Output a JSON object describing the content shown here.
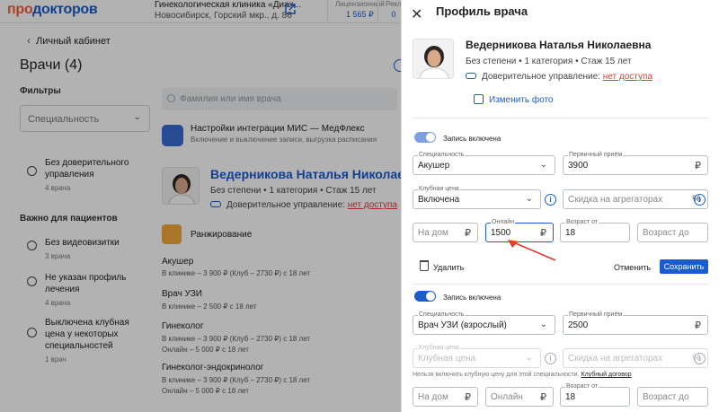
{
  "header": {
    "logo_prefix": "про",
    "logo_main": "докторов",
    "clinic_name": "Гинекологическая клиника «Диах...",
    "clinic_address": "Новосибирск, Горский мкр., д. 86",
    "stats": [
      {
        "label": "Лицензионный",
        "value": "1 565 ₽"
      },
      {
        "label": "Рекл",
        "value": "0"
      }
    ]
  },
  "background": {
    "back_link": "Личный кабинет",
    "page_title": "Врачи (4)",
    "filters_title": "Фильтры",
    "specialty_placeholder": "Специальность",
    "filter_trust": {
      "label": "Без доверительного управления",
      "count": "4 врача"
    },
    "important_title": "Важно для пациентов",
    "filters": [
      {
        "label": "Без видеовизитки",
        "count": "3 врача"
      },
      {
        "label": "Не указан профиль лечения",
        "count": "4 врача"
      },
      {
        "label": "Выключена клубная цена у некоторых специальностей",
        "count": "1 врач"
      }
    ],
    "search_placeholder": "Фамилия или имя врача",
    "mis": {
      "title": "Настройки интеграции МИС — МедФлекс",
      "subtitle": "Включение и выключение записи, выгрузка расписания"
    },
    "doctor": {
      "name": "Ведерникова Наталья Николаевна",
      "meta": "Без степени  •  1 категория  •  Стаж 15 лет",
      "trust_label": "Доверительное управление:",
      "trust_value": "нет доступа"
    },
    "ranking_label": "Ранжирование",
    "services": [
      {
        "name": "Акушер",
        "lines": [
          "В клинике – 3 900 ₽ (Клуб – 2730 ₽) с 18 лет"
        ]
      },
      {
        "name": "Врач УЗИ",
        "lines": [
          "В клинике – 2 500 ₽ с 18 лет"
        ]
      },
      {
        "name": "Гинеколог",
        "lines": [
          "В клинике – 3 900 ₽ (Клуб – 2730 ₽) с 18 лет",
          "Онлайн – 5 000 ₽ с 18 лет"
        ]
      },
      {
        "name": "Гинеколог-эндокринолог",
        "lines": [
          "В клинике – 3 900 ₽ (Клуб – 2730 ₽) с 18 лет",
          "Онлайн – 5 000 ₽ с 18 лет"
        ]
      }
    ]
  },
  "panel": {
    "title": "Профиль врача",
    "doctor_name": "Ведерникова Наталья Николаевна",
    "meta": "Без степени  •  1 категория  •  Стаж 15 лет",
    "trust_label": "Доверительное управление:",
    "trust_value": "нет доступа",
    "edit_photo": "Изменить фото",
    "specialty_label": "Специальность",
    "primary_label": "Первичный приём",
    "club_label": "Клубная цена",
    "discount_placeholder": "Скидка на агрегаторах",
    "home_placeholder": "На дом",
    "online_label": "Онлайн",
    "online_placeholder": "Онлайн",
    "age_label": "Возраст от",
    "age_to_placeholder": "Возраст до",
    "currency": "₽",
    "percent": "%",
    "info_glyph": "i",
    "blocks": [
      {
        "toggle_label": "Запись включена",
        "specialty": "Акушер",
        "primary_price": "3900",
        "club_value": "Включена",
        "online_price": "1500",
        "age_from": "18"
      },
      {
        "toggle_label": "Запись включена",
        "specialty": "Врач УЗИ (взрослый)",
        "primary_price": "2500",
        "club_placeholder": "Клубная цена",
        "age_from": "18"
      }
    ],
    "delete_label": "Удалить",
    "cancel_label": "Отменить",
    "save_label": "Сохранить",
    "club_note": "Нельзя включить клубную цену для этой специальности.",
    "club_note_link": "Клубный договор"
  },
  "colors": {
    "accent": "#1a5ccc",
    "toggle_on_first": "#7f9ee5",
    "toggle_on_second": "#1a5ccc",
    "danger": "#e53935",
    "arrow": "#e53935"
  },
  "icons": [
    "close-icon",
    "chevron-down-icon",
    "ruble-icon",
    "info-icon",
    "trash-icon",
    "photo-edit-icon",
    "handshake-icon",
    "external-link-icon",
    "search-icon",
    "ranking-icon",
    "mis-icon"
  ]
}
